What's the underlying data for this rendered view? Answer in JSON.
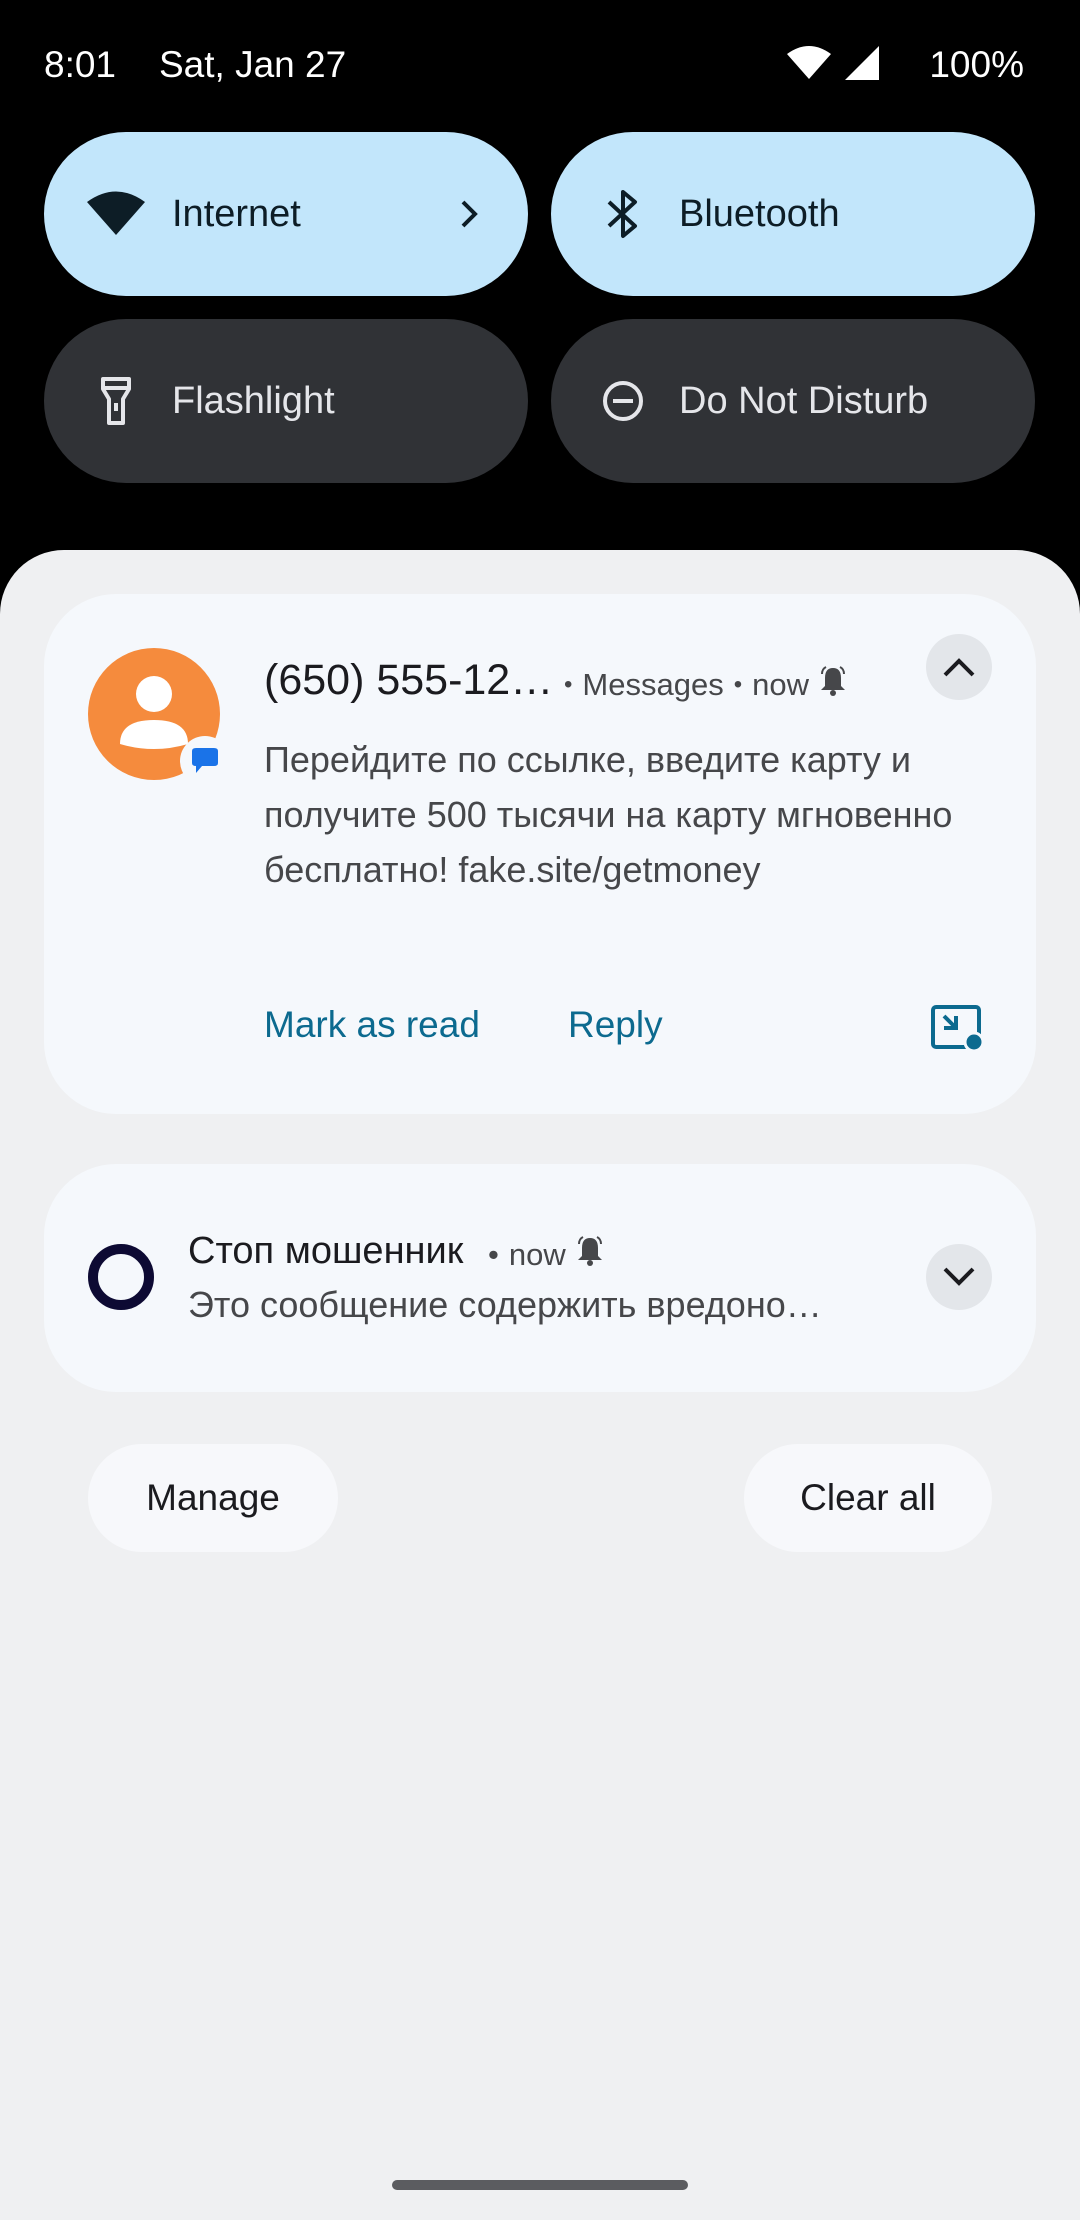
{
  "status_bar": {
    "time": "8:01",
    "date": "Sat, Jan 27",
    "battery": "100%",
    "icons": [
      "wifi-icon",
      "cell-signal-icon"
    ]
  },
  "quick_settings": {
    "tiles": [
      {
        "label": "Internet",
        "icon": "wifi-icon",
        "state": "active",
        "has_chevron": true
      },
      {
        "label": "Bluetooth",
        "icon": "bluetooth-icon",
        "state": "active"
      },
      {
        "label": "Flashlight",
        "icon": "flashlight-icon",
        "state": "inactive"
      },
      {
        "label": "Do Not Disturb",
        "icon": "do-not-disturb-icon",
        "state": "inactive"
      }
    ]
  },
  "notifications": [
    {
      "title": "(650) 555-12…",
      "app": "Messages",
      "time": "now",
      "body": "Перейдите по ссылке, введите карту и получите 500 тысячи на карту мгновенно бесплатно! fake.site/getmoney",
      "actions": [
        "Mark as read",
        "Reply"
      ],
      "expanded": true
    },
    {
      "title": "Стоп мошенник",
      "time": "now",
      "body": "Это сообщение содержить вредоно…",
      "expanded": false
    }
  ],
  "footer": {
    "manage_label": "Manage",
    "clear_all_label": "Clear all"
  },
  "colors": {
    "tile_active": "#c2e6fb",
    "tile_inactive": "#303236",
    "shade": "#eff0f2",
    "card": "#f5f8fc",
    "accent": "#0c6a8f",
    "avatar": "#f58b3d"
  }
}
